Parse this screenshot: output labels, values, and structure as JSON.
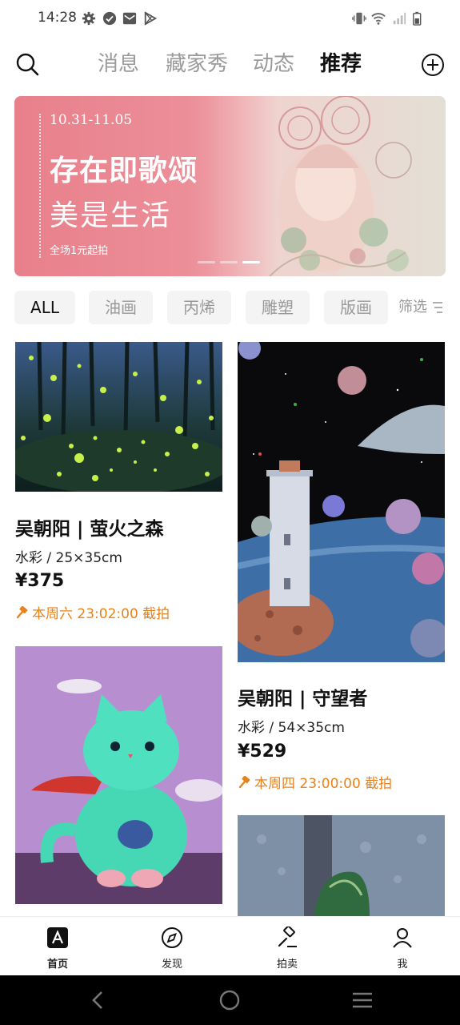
{
  "status_bar": {
    "time": "14:28"
  },
  "top_nav": {
    "tabs": [
      {
        "label": "消息",
        "active": false
      },
      {
        "label": "藏家秀",
        "active": false
      },
      {
        "label": "动态",
        "active": false
      },
      {
        "label": "推荐",
        "active": true
      }
    ]
  },
  "banner": {
    "date": "10.31-11.05",
    "title_line1": "存在即歌颂",
    "title_line2": "美是生活",
    "note": "全场1元起拍",
    "slide_count": 3,
    "active_slide": 3
  },
  "filters": {
    "chips": [
      {
        "label": "ALL",
        "active": true
      },
      {
        "label": "油画",
        "active": false
      },
      {
        "label": "丙烯",
        "active": false
      },
      {
        "label": "雕塑",
        "active": false
      },
      {
        "label": "版画",
        "active": false
      }
    ],
    "filter_label": "筛选"
  },
  "products": [
    {
      "title": "吴朝阳 | 萤火之森",
      "meta": "水彩 / 25×35cm",
      "price": "¥375",
      "end_time": "本周六 23:02:00 截拍"
    },
    {
      "title": "吴朝阳 | 守望者",
      "meta": "水彩 / 54×35cm",
      "price": "¥529",
      "end_time": "本周四 23:00:00 截拍"
    }
  ],
  "tabbar": {
    "items": [
      {
        "label": "首页",
        "icon": "home-logo-icon",
        "active": true
      },
      {
        "label": "发现",
        "icon": "compass-icon",
        "active": false
      },
      {
        "label": "拍卖",
        "icon": "auction-hammer-icon",
        "active": false
      },
      {
        "label": "我",
        "icon": "user-icon",
        "active": false
      }
    ]
  },
  "colors": {
    "accent_orange": "#e8821d",
    "banner_pink": "#e8808b",
    "muted_text": "#9a9a9a"
  }
}
